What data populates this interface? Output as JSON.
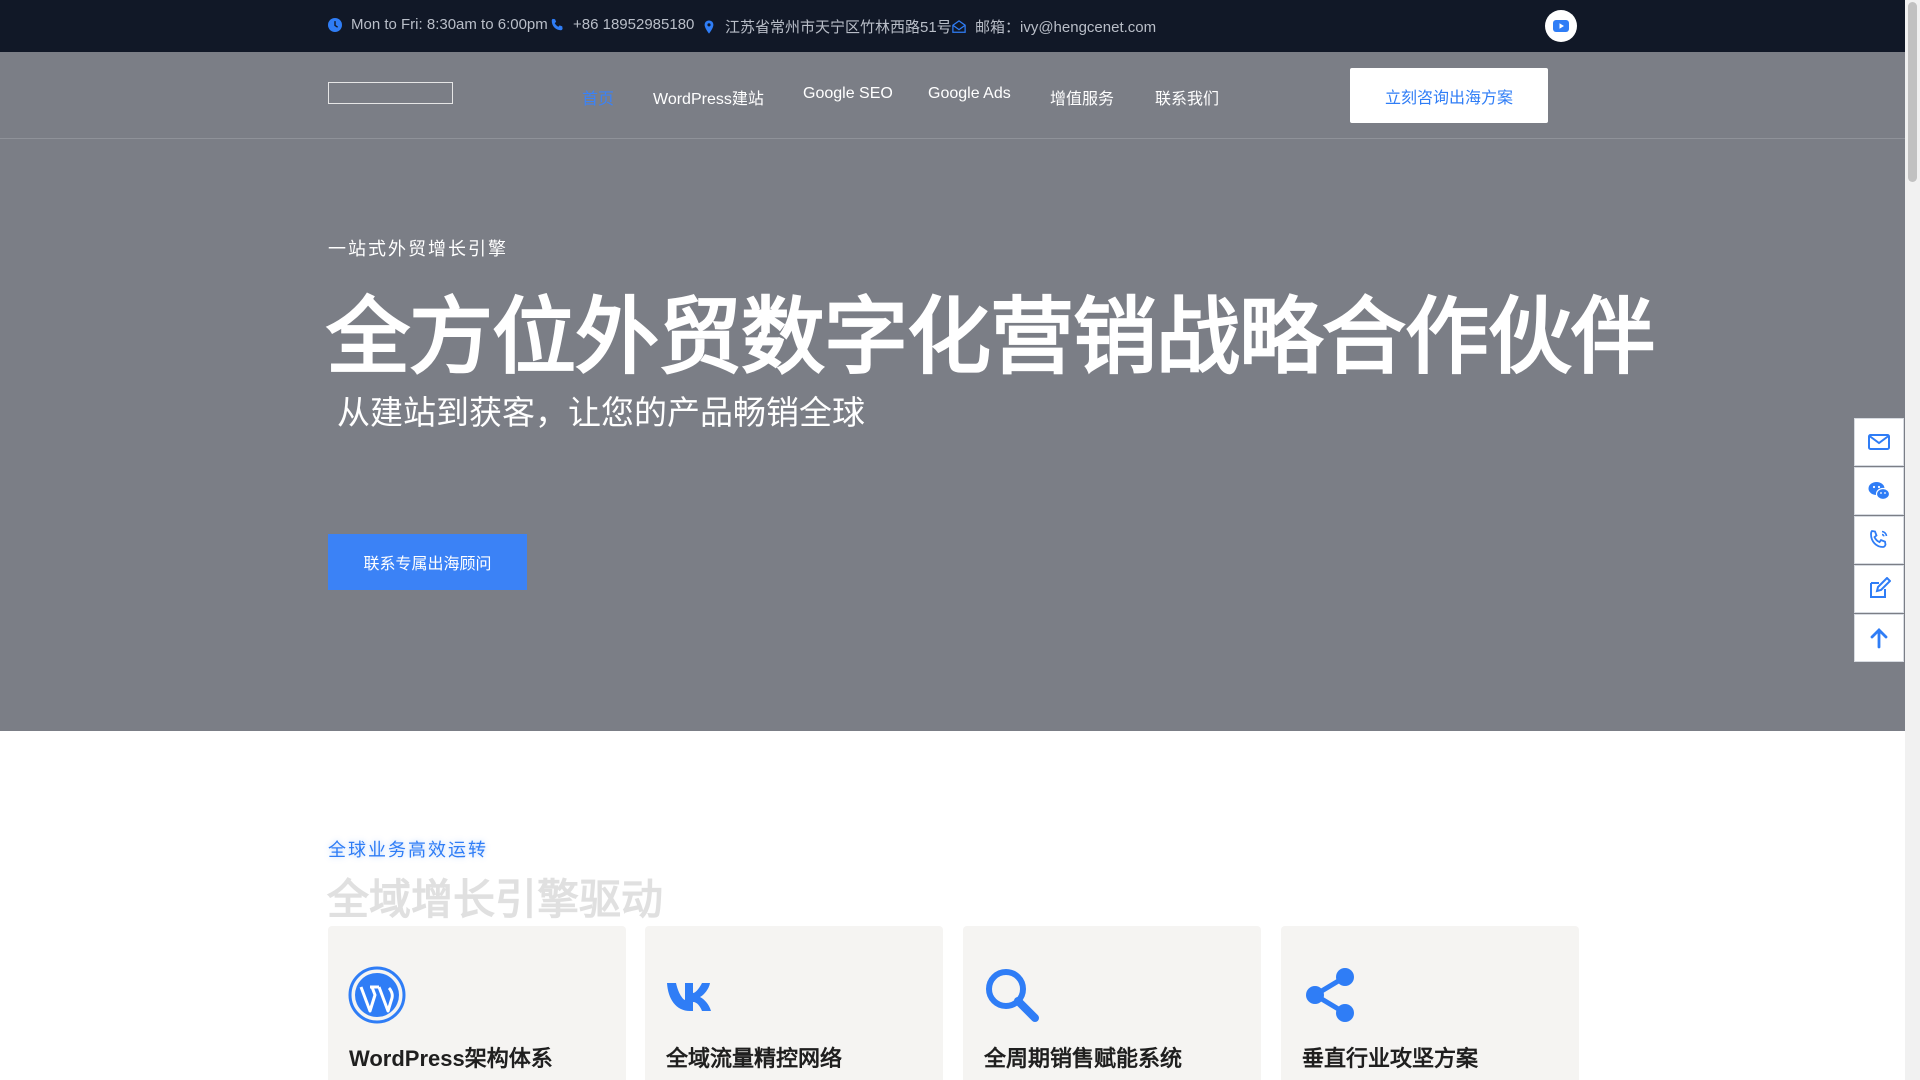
{
  "topbar": {
    "hours": "Mon to Fri: 8:30am to 6:00pm",
    "phone": "+86 18952985180",
    "address": "江苏省常州市天宁区竹林西路51号",
    "email": "邮箱：ivy@hengcenet.com",
    "social_icon": "youtube-icon"
  },
  "nav": {
    "items": [
      {
        "label": "首页",
        "active": true
      },
      {
        "label": "WordPress建站"
      },
      {
        "label": "Google SEO"
      },
      {
        "label": "Google Ads"
      },
      {
        "label": "增值服务"
      },
      {
        "label": "联系我们"
      }
    ],
    "cta": "立刻咨询出海方案"
  },
  "hero": {
    "eyebrow": "一站式外贸增长引擎",
    "headline": "全方位外贸数字化营销战略合作伙伴",
    "subline": "从建站到获客，让您的产品畅销全球",
    "button": "联系专属出海顾问"
  },
  "side_tools": [
    "email-icon",
    "wechat-icon",
    "phone-icon",
    "edit-icon",
    "arrow-up-icon"
  ],
  "section": {
    "eyebrow": "全球业务高效运转",
    "title": "全域增长引擎驱动",
    "cards": [
      {
        "icon": "wordpress-icon",
        "title": "WordPress架构体系"
      },
      {
        "icon": "vk-icon",
        "title": "全域流量精控网络"
      },
      {
        "icon": "search-icon",
        "title": "全周期销售赋能系统"
      },
      {
        "icon": "share-icon",
        "title": "垂直行业攻坚方案"
      }
    ]
  },
  "colors": {
    "accent": "#2f7df6",
    "topbar_bg": "#111827",
    "hero_overlay": "#7b7e86",
    "card_bg": "#f5f4f2"
  }
}
